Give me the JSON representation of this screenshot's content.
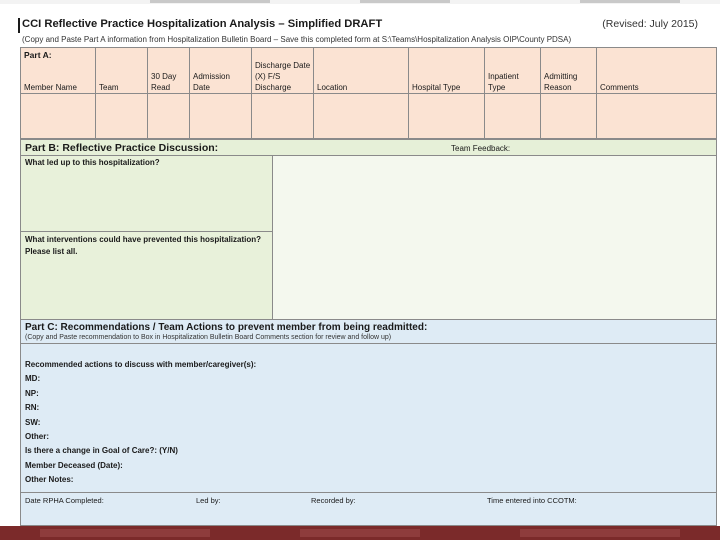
{
  "document": {
    "title": "CCI Reflective Practice Hospitalization Analysis – Simplified DRAFT",
    "revised": "(Revised: July 2015)",
    "instructions": "(Copy and Paste Part A information from Hospitalization Bulletin Board – Save this completed form at S:\\Teams\\Hospitalization Analysis OIP\\County PDSA)"
  },
  "part_a": {
    "title": "Part A:",
    "columns": [
      "Member Name",
      "Team",
      "30 Day Read",
      "Admission Date",
      "Discharge Date (X) F/S Discharge",
      "Location",
      "Hospital Type",
      "Inpatient Type",
      "Admitting Reason",
      "Comments"
    ]
  },
  "part_b": {
    "title": "Part B: Reflective Practice Discussion:",
    "feedback_label": "Team Feedback:",
    "question_1": "What led up to this hospitalization?",
    "question_2": "What interventions could have prevented this hospitalization? Please list all."
  },
  "part_c": {
    "title": "Part C: Recommendations / Team Actions to prevent member from being readmitted:",
    "subtitle": "(Copy and Paste recommendation to Box in Hospitalization Bulletin Board Comments section for review and follow up)",
    "items": [
      "Recommended actions to discuss with member/caregiver(s):",
      "MD:",
      "NP:",
      "RN:",
      "SW:",
      "Other:",
      "Is there a change in Goal of Care?: (Y/N)",
      "Member Deceased (Date):",
      "Other Notes:"
    ],
    "footer": [
      "Date RPHA Completed:",
      "Led by:",
      "Recorded by:",
      "Time entered into CCOTM:"
    ]
  },
  "colors": {
    "part_a_bg": "#fbe3d3",
    "part_b_bg": "#e6f0d8",
    "part_c_bg": "#deebf5",
    "bottom_bar": "#7b2a2a"
  }
}
